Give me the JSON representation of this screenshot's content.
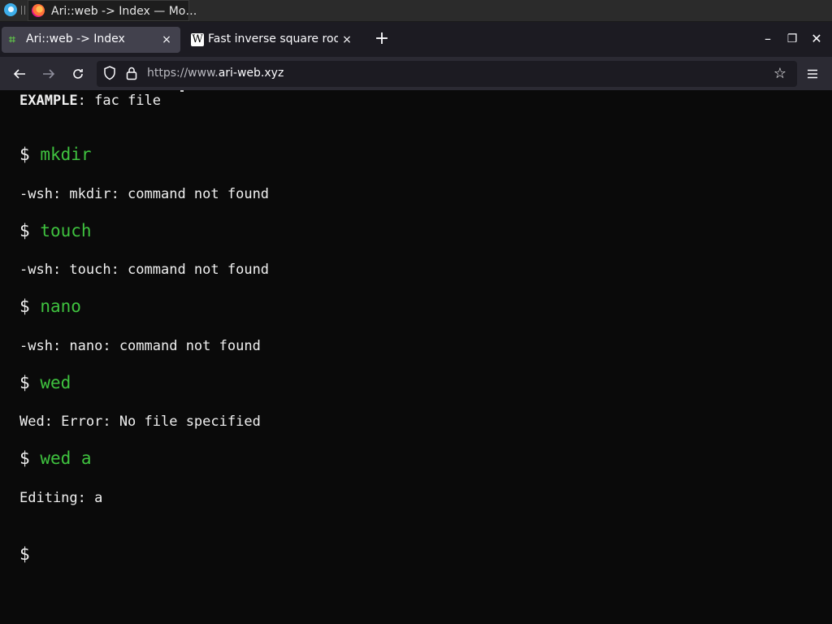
{
  "taskbar": {
    "window_title": "Ari::web -> Index — Mo…"
  },
  "tabs": [
    {
      "label": "Ari::web -> Index",
      "favicon": "ari-web-icon",
      "active": true
    },
    {
      "label": "Fast inverse square root",
      "favicon": "wikipedia-icon",
      "active": false
    }
  ],
  "tab_close_glyph": "×",
  "new_tab_glyph": "+",
  "window_controls": {
    "minimize": "–",
    "maximize": "❐",
    "close": "✕"
  },
  "navbar": {
    "url_scheme": "https://www.",
    "url_host": "ari-web.xyz"
  },
  "terminal": {
    "example_label": "EXAMPLE",
    "example_text": ": fac file",
    "prompt": "$",
    "entries": [
      {
        "command": "mkdir",
        "output": "-wsh: mkdir: command not found"
      },
      {
        "command": "touch",
        "output": "-wsh: touch: command not found"
      },
      {
        "command": "nano",
        "output": "-wsh: nano: command not found"
      },
      {
        "command": "wed",
        "output": "Wed: Error: No file specified"
      },
      {
        "command": "wed a",
        "output": "Editing: a"
      }
    ],
    "colors": {
      "command": "#3fc23f",
      "text": "#f0f0f0",
      "background": "#0a0a0a"
    }
  }
}
